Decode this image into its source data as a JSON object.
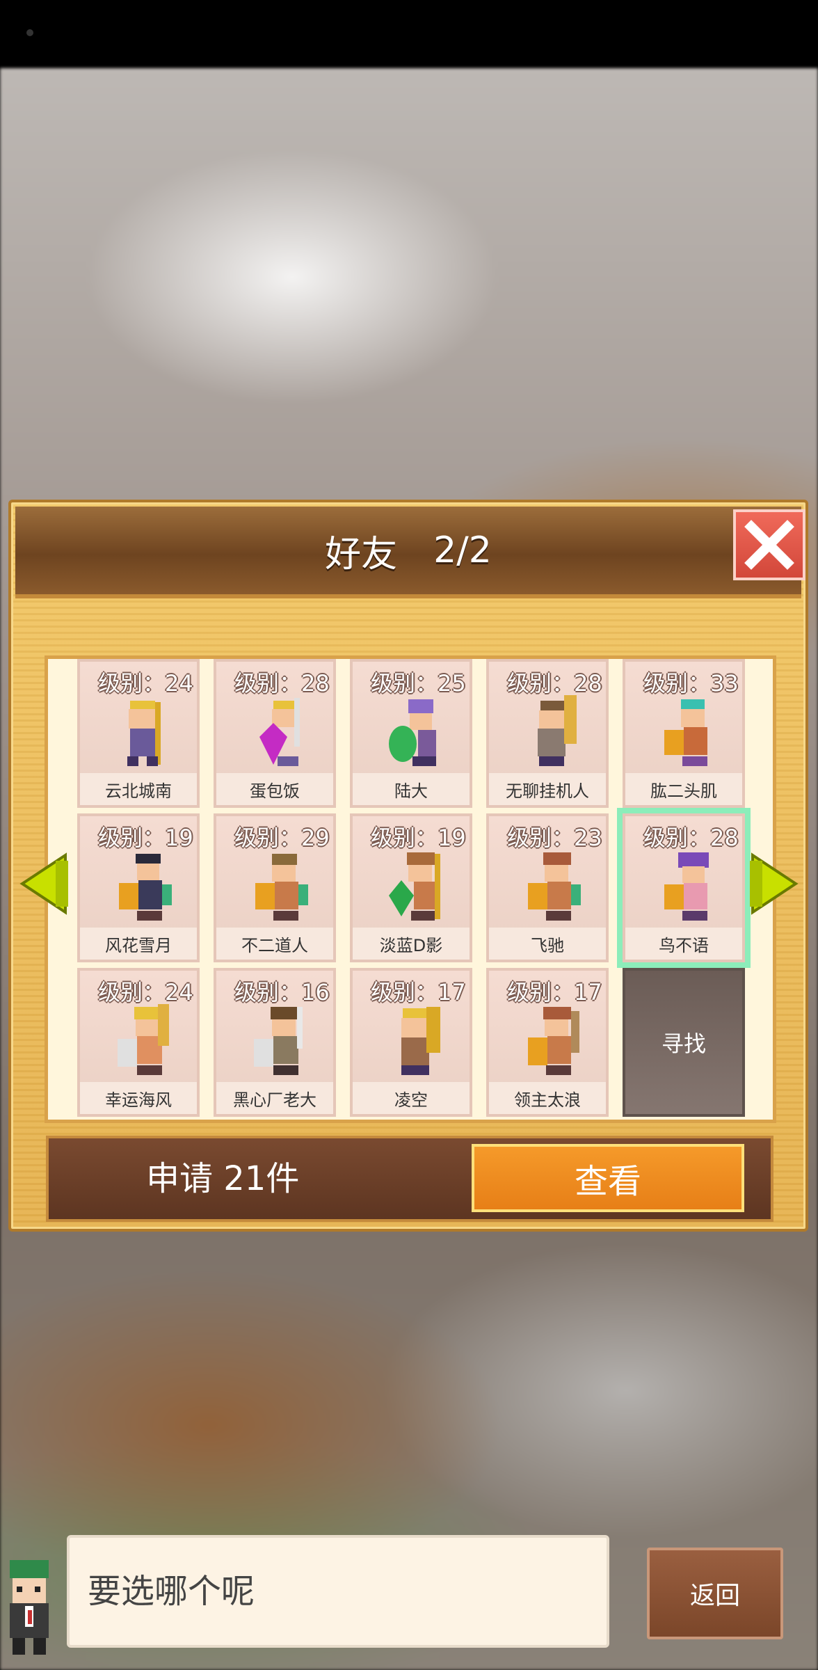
{
  "panel": {
    "title": "好友",
    "page": "2/2"
  },
  "friends": [
    {
      "level": "级别：24",
      "name": "云北城南"
    },
    {
      "level": "级别：28",
      "name": "蛋包饭"
    },
    {
      "level": "级别：25",
      "name": "陆大"
    },
    {
      "level": "级别：28",
      "name": "无聊挂机人"
    },
    {
      "level": "级别：33",
      "name": "肱二头肌"
    },
    {
      "level": "级别：19",
      "name": "风花雪月"
    },
    {
      "level": "级别：29",
      "name": "不二道人"
    },
    {
      "level": "级别：19",
      "name": "淡蓝D影"
    },
    {
      "level": "级别：23",
      "name": "飞驰"
    },
    {
      "level": "级别：28",
      "name": "鸟不语"
    },
    {
      "level": "级别：24",
      "name": "幸运海风"
    },
    {
      "level": "级别：16",
      "name": "黑心厂老大"
    },
    {
      "level": "级别：17",
      "name": "凌空"
    },
    {
      "level": "级别：17",
      "name": "领主太浪"
    }
  ],
  "find_label": "寻找",
  "request": {
    "text": "申请 21件",
    "view_label": "查看"
  },
  "dialog": {
    "text": "要选哪个呢",
    "back_label": "返回"
  },
  "colors": {
    "accent_orange": "#e77f17",
    "close_red": "#d2473a",
    "selected_green": "#78ebb4",
    "arrow_yellow": "#c8e000"
  }
}
